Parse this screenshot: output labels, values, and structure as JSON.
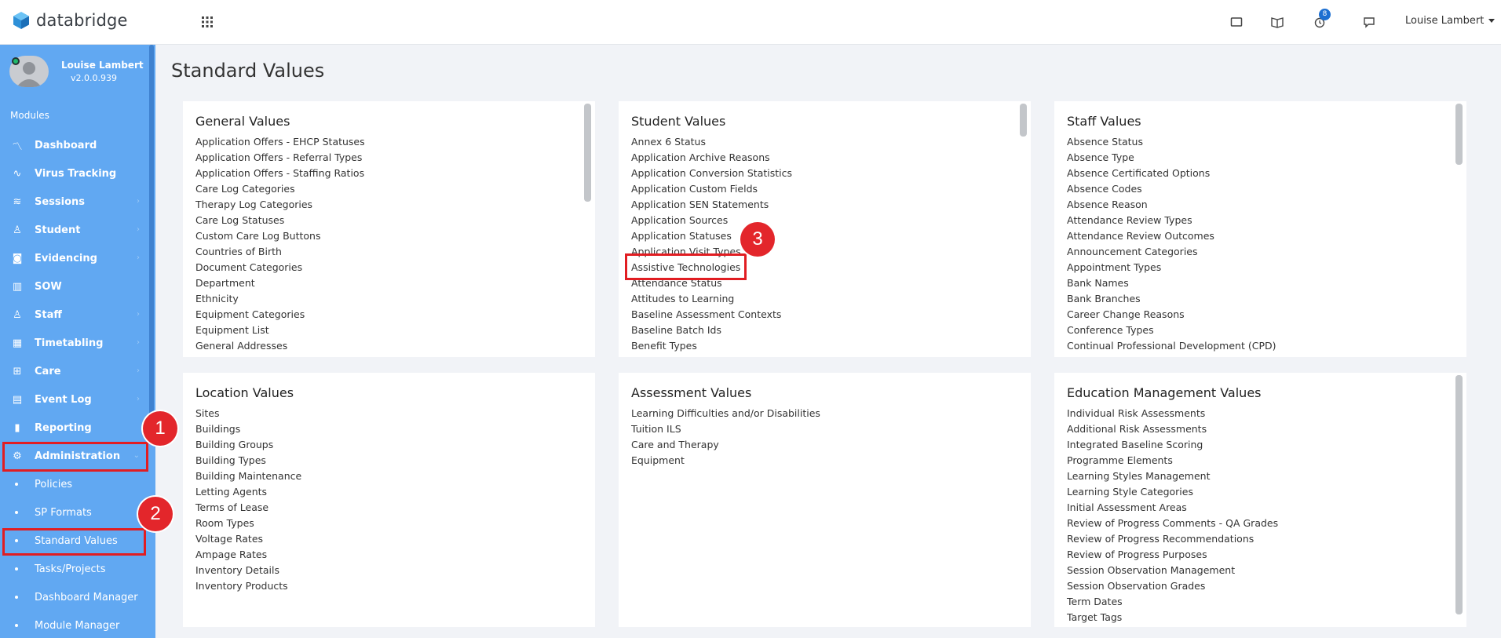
{
  "app": {
    "name": "databridge"
  },
  "header": {
    "notification_count": "8",
    "user_menu_label": "Louise Lambert"
  },
  "sidebar": {
    "profile": {
      "name": "Louise Lambert",
      "version": "v2.0.0.939"
    },
    "modules_label": "Modules",
    "items": [
      {
        "label": "Dashboard"
      },
      {
        "label": "Virus Tracking"
      },
      {
        "label": "Sessions"
      },
      {
        "label": "Student"
      },
      {
        "label": "Evidencing"
      },
      {
        "label": "SOW"
      },
      {
        "label": "Staff"
      },
      {
        "label": "Timetabling"
      },
      {
        "label": "Care"
      },
      {
        "label": "Event Log"
      },
      {
        "label": "Reporting"
      },
      {
        "label": "Administration"
      }
    ],
    "sub_items": [
      {
        "label": "Policies"
      },
      {
        "label": "SP Formats"
      },
      {
        "label": "Standard Values"
      },
      {
        "label": "Tasks/Projects"
      },
      {
        "label": "Dashboard Manager"
      },
      {
        "label": "Module Manager"
      }
    ]
  },
  "annotations": {
    "marker1": "1",
    "marker2": "2",
    "marker3": "3"
  },
  "main": {
    "title": "Standard Values",
    "panels": [
      {
        "title": "General Values",
        "items": [
          "Application Offers - EHCP Statuses",
          "Application Offers - Referral Types",
          "Application Offers - Staffing Ratios",
          "Care Log Categories",
          "Therapy Log Categories",
          "Care Log Statuses",
          "Custom Care Log Buttons",
          "Countries of Birth",
          "Document Categories",
          "Department",
          "Ethnicity",
          "Equipment Categories",
          "Equipment List",
          "General Addresses"
        ]
      },
      {
        "title": "Student Values",
        "items": [
          "Annex 6 Status",
          "Application Archive Reasons",
          "Application Conversion Statistics",
          "Application Custom Fields",
          "Application SEN Statements",
          "Application Sources",
          "Application Statuses",
          "Application Visit Types",
          "Assistive Technologies",
          "Attendance Status",
          "Attitudes to Learning",
          "Baseline Assessment Contexts",
          "Baseline Batch Ids",
          "Benefit Types"
        ]
      },
      {
        "title": "Staff Values",
        "items": [
          "Absence Status",
          "Absence Type",
          "Absence Certificated Options",
          "Absence Codes",
          "Absence Reason",
          "Attendance Review Types",
          "Attendance Review Outcomes",
          "Announcement Categories",
          "Appointment Types",
          "Bank Names",
          "Bank Branches",
          "Career Change Reasons",
          "Conference Types",
          "Continual Professional Development (CPD)"
        ]
      },
      {
        "title": "Location Values",
        "items": [
          "Sites",
          "Buildings",
          "Building Groups",
          "Building Types",
          "Building Maintenance",
          "Letting Agents",
          "Terms of Lease",
          "Room Types",
          "Voltage Rates",
          "Ampage Rates",
          "Inventory Details",
          "Inventory Products"
        ]
      },
      {
        "title": "Assessment Values",
        "items": [
          "Learning Difficulties and/or Disabilities",
          "Tuition ILS",
          "Care and Therapy",
          "Equipment"
        ]
      },
      {
        "title": "Education Management Values",
        "items": [
          "Individual Risk Assessments",
          "Additional Risk Assessments",
          "Integrated Baseline Scoring",
          "Programme Elements",
          "Learning Styles Management",
          "Learning Style Categories",
          "Initial Assessment Areas",
          "Review of Progress Comments - QA Grades",
          "Review of Progress Recommendations",
          "Review of Progress Purposes",
          "Session Observation Management",
          "Session Observation Grades",
          "Term Dates",
          "Target Tags"
        ]
      }
    ]
  }
}
